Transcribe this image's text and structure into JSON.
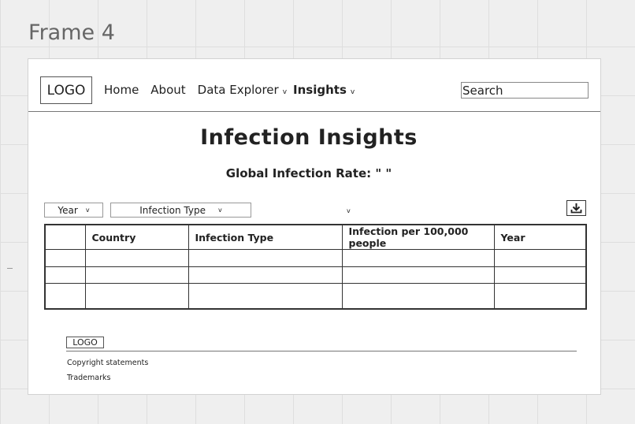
{
  "frame_title": "Frame 4",
  "header": {
    "logo": "LOGO",
    "nav": [
      {
        "label": "Home"
      },
      {
        "label": "About"
      },
      {
        "label": "Data Explorer"
      },
      {
        "label": "Insights"
      }
    ],
    "search_placeholder": "Search"
  },
  "main": {
    "title": "Infection  Insights",
    "global_rate_label": "Global Infection Rate: \"     \"",
    "filters": {
      "year": "Year",
      "infection_type": "Infection Type"
    },
    "table": {
      "headers": [
        "",
        "Country",
        "Infection Type",
        "Infection per 100,000 people",
        "Year"
      ],
      "rows": [
        [
          "",
          "",
          "",
          "",
          ""
        ],
        [
          "",
          "",
          "",
          "",
          ""
        ],
        [
          "",
          "",
          "",
          "",
          ""
        ]
      ]
    }
  },
  "footer": {
    "logo": "LOGO",
    "copyright": "Copyright statements",
    "trademarks": "Trademarks"
  }
}
